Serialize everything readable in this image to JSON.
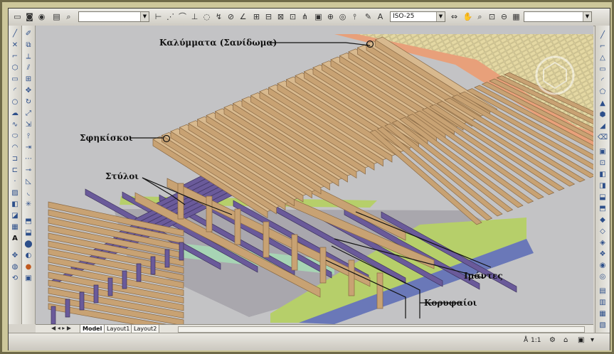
{
  "toolbar": {
    "layer_combo": "",
    "dim_style_combo": "ISO-25",
    "right_combo": ""
  },
  "layout_tabs": [
    {
      "label": "Model",
      "active": true
    },
    {
      "label": "Layout1",
      "active": false
    },
    {
      "label": "Layout2",
      "active": false
    }
  ],
  "annotations": {
    "roof_cover": "Καλύμματα (Σανίδωμα)",
    "wedges": "Σφηκίσκοι",
    "posts": "Στύλοι",
    "straps": "Ιμάντες",
    "ridges": "Κορυφαίοι"
  },
  "status": {
    "scale": "1:1"
  },
  "colors": {
    "timber": "#c8a273",
    "timber_dark": "#8a6a45",
    "beam_purple": "#6a5a9a",
    "tile": "#e9dfb1",
    "roof_edge": "#e8a07a",
    "wall_green": "#b6cf6a",
    "wall_blue": "#6a78b8"
  }
}
